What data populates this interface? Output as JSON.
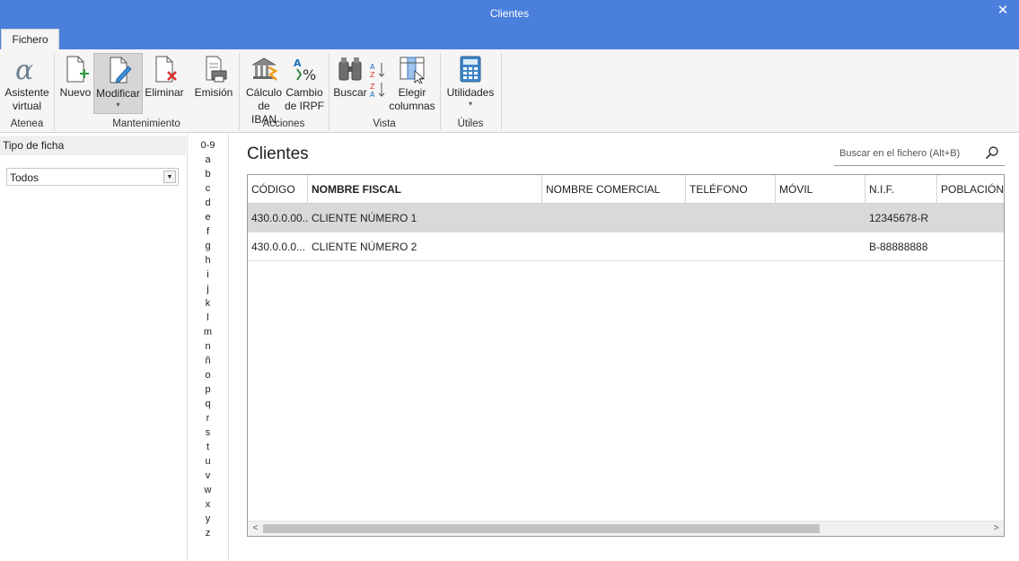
{
  "window": {
    "title": "Clientes",
    "close_icon": "✕"
  },
  "ribbon": {
    "tab": "Fichero",
    "groups": {
      "atenea": "Atenea",
      "mantenimiento": "Mantenimiento",
      "acciones": "Acciones",
      "vista": "Vista",
      "utiles": "Útiles"
    },
    "buttons": {
      "asistente_1": "Asistente",
      "asistente_2": "virtual",
      "nuevo": "Nuevo",
      "modificar": "Modificar",
      "eliminar": "Eliminar",
      "emision": "Emisión",
      "calculo_1": "Cálculo",
      "calculo_2": "de IBAN",
      "cambio_1": "Cambio",
      "cambio_2": "de IRPF",
      "buscar": "Buscar",
      "elegir_1": "Elegir",
      "elegir_2": "columnas",
      "utilidades": "Utilidades"
    },
    "caret": "▾"
  },
  "left_panel": {
    "header": "Tipo de ficha",
    "combo_value": "Todos",
    "combo_arrow": "▼"
  },
  "alphabet": [
    "0-9",
    "a",
    "b",
    "c",
    "d",
    "e",
    "f",
    "g",
    "h",
    "i",
    "j",
    "k",
    "l",
    "m",
    "n",
    "ñ",
    "o",
    "p",
    "q",
    "r",
    "s",
    "t",
    "u",
    "v",
    "w",
    "x",
    "y",
    "z"
  ],
  "main": {
    "title": "Clientes",
    "search_placeholder": "Buscar en el fichero (Alt+B)"
  },
  "grid": {
    "columns": [
      "CÓDIGO",
      "NOMBRE FISCAL",
      "NOMBRE COMERCIAL",
      "TELÉFONO",
      "MÓVIL",
      "N.I.F.",
      "POBLACIÓN"
    ],
    "rows": [
      {
        "codigo": "430.0.0.00...",
        "nombre_fiscal": "CLIENTE NÚMERO 1",
        "nombre_comercial": "",
        "telefono": "",
        "movil": "",
        "nif": "12345678-R",
        "poblacion": ""
      },
      {
        "codigo": "430.0.0.0...",
        "nombre_fiscal": "CLIENTE NÚMERO 2",
        "nombre_comercial": "",
        "telefono": "",
        "movil": "",
        "nif": "B-88888888",
        "poblacion": ""
      }
    ],
    "scroll_left": "<",
    "scroll_right": ">"
  }
}
